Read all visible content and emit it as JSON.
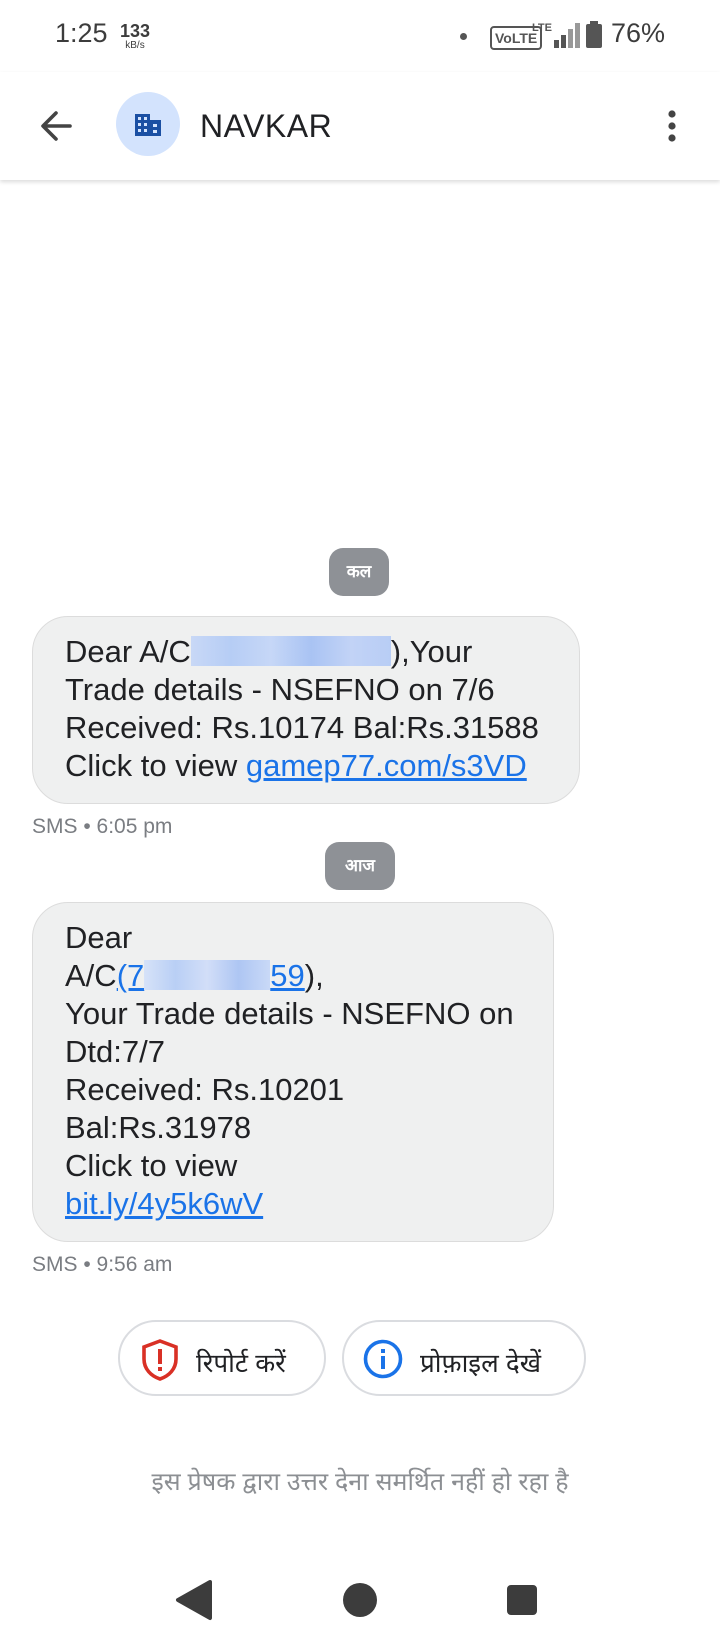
{
  "status_bar": {
    "time": "1:25",
    "speed_value": "133",
    "speed_unit": "kB/s",
    "volte": "VoLTE",
    "network": "LTE",
    "battery_pct": "76%"
  },
  "app_bar": {
    "title": "NAVKAR",
    "back_icon": "arrow-back-icon",
    "avatar_icon": "business-icon",
    "more_icon": "more-vert-icon"
  },
  "conversation": [
    {
      "date_label": "कल",
      "lines": [
        {
          "pre": "Dear A/C",
          "redacted": true,
          "post": "),Your"
        },
        {
          "text": "Trade details - NSEFNO on 7/6"
        },
        {
          "text": "Received: Rs.10174 Bal:Rs.31588"
        },
        {
          "pre": "Click to view ",
          "link": "gamep77.com/s3VD"
        }
      ],
      "meta": "SMS • 6:05 pm"
    },
    {
      "date_label": "आज",
      "lines": [
        {
          "text": "Dear"
        },
        {
          "pre": "A/C",
          "link_start": "(7",
          "redacted": true,
          "link_end": "59",
          "post": "),"
        },
        {
          "text": "Your Trade details - NSEFNO on"
        },
        {
          "text": "Dtd:7/7"
        },
        {
          "text": "Received: Rs.10201"
        },
        {
          "text": "Bal:Rs.31978"
        },
        {
          "text": "Click to view"
        },
        {
          "link": "bit.ly/4y5k6wV"
        }
      ],
      "meta": "SMS • 9:56 am"
    }
  ],
  "actions": {
    "report_label": "रिपोर्ट करें",
    "report_icon": "shield-alert-icon",
    "profile_label": "प्रोफ़ाइल देखें",
    "profile_icon": "info-icon"
  },
  "footer_note": "इस प्रेषक द्वारा उत्तर देना समर्थित नहीं हो रहा है",
  "colors": {
    "link": "#1a73e8",
    "bubble": "#eff0f0",
    "chip": "#8e9196",
    "avatar_bg": "#d3e3fd",
    "report_red": "#d93025",
    "info_blue": "#1a73e8"
  }
}
